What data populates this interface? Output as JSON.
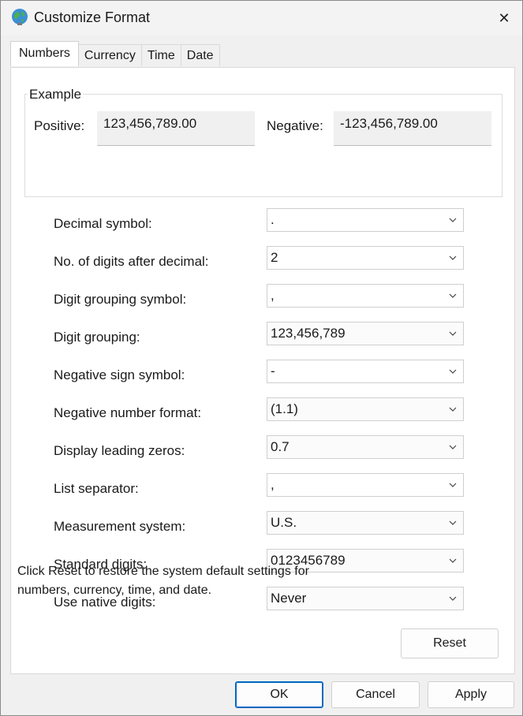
{
  "window": {
    "title": "Customize Format",
    "close_glyph": "✕"
  },
  "tabs": [
    {
      "label": "Numbers",
      "active": true
    },
    {
      "label": "Currency",
      "active": false
    },
    {
      "label": "Time",
      "active": false
    },
    {
      "label": "Date",
      "active": false
    }
  ],
  "example": {
    "legend": "Example",
    "positive_label": "Positive:",
    "positive_value": "123,456,789.00",
    "negative_label": "Negative:",
    "negative_value": "-123,456,789.00"
  },
  "settings": [
    {
      "label": "Decimal symbol:",
      "value": "."
    },
    {
      "label": "No. of digits after decimal:",
      "value": "2"
    },
    {
      "label": "Digit grouping symbol:",
      "value": ","
    },
    {
      "label": "Digit grouping:",
      "value": "123,456,789"
    },
    {
      "label": "Negative sign symbol:",
      "value": "-"
    },
    {
      "label": "Negative number format:",
      "value": "(1.1)"
    },
    {
      "label": "Display leading zeros:",
      "value": "0.7"
    },
    {
      "label": "List separator:",
      "value": ","
    },
    {
      "label": "Measurement system:",
      "value": "U.S."
    },
    {
      "label": "Standard digits:",
      "value": "0123456789"
    },
    {
      "label": "Use native digits:",
      "value": "Never"
    }
  ],
  "reset": {
    "note": "Click Reset to restore the system default settings for numbers, currency, time, and date.",
    "button_label": "Reset"
  },
  "footer": {
    "ok_label": "OK",
    "cancel_label": "Cancel",
    "apply_label": "Apply"
  },
  "colors": {
    "accent": "#0067c0",
    "panel_bg": "#ffffff",
    "window_bg": "#f0f0f0"
  },
  "icons": {
    "app": "globe-icon",
    "close": "close-icon",
    "dropdown": "chevron-down-icon"
  }
}
